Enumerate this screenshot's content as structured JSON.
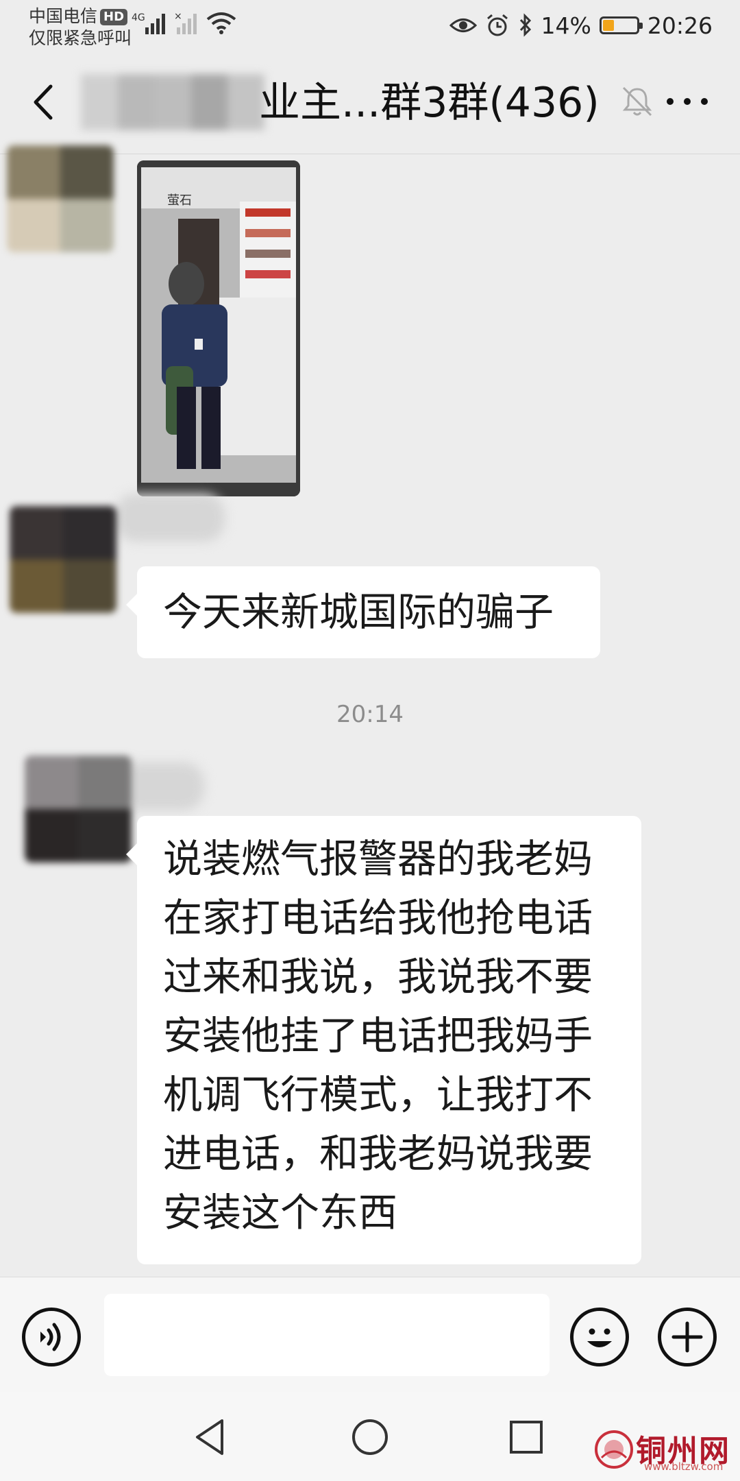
{
  "status_bar": {
    "carrier": "中国电信",
    "carrier_badge": "HD",
    "emergency_text": "仅限紧急呼叫",
    "network": "4G",
    "battery_percent": "14%",
    "battery_level": 0.14,
    "time": "20:26"
  },
  "header": {
    "title": "业主...群3群(436)",
    "icons": [
      "back-icon",
      "mute-icon",
      "more-icon"
    ]
  },
  "messages": [
    {
      "type": "image",
      "description_icon": "surveillance-photo"
    },
    {
      "type": "text",
      "text": "今天来新城国际的骗子"
    },
    {
      "type": "time",
      "text": "20:14"
    },
    {
      "type": "text",
      "text": "说装燃气报警器的我老妈\n在家打电话给我他抢电话\n过来和我说，我说我不要\n安装他挂了电话把我妈手\n机调飞行模式，让我打不\n进电话，和我老妈说我要\n安装这个东西"
    }
  ],
  "photo": {
    "camera_brand": "萤石"
  },
  "input_bar": {
    "placeholder": "",
    "icons": [
      "voice-icon",
      "emoji-icon",
      "plus-icon"
    ]
  },
  "watermark": {
    "brand": "铜州网",
    "url": "www.bltzw.com"
  },
  "colors": {
    "background": "#ededed",
    "bubble": "#ffffff",
    "battery": "#f2a51a",
    "watermark": "#b11a2b"
  }
}
